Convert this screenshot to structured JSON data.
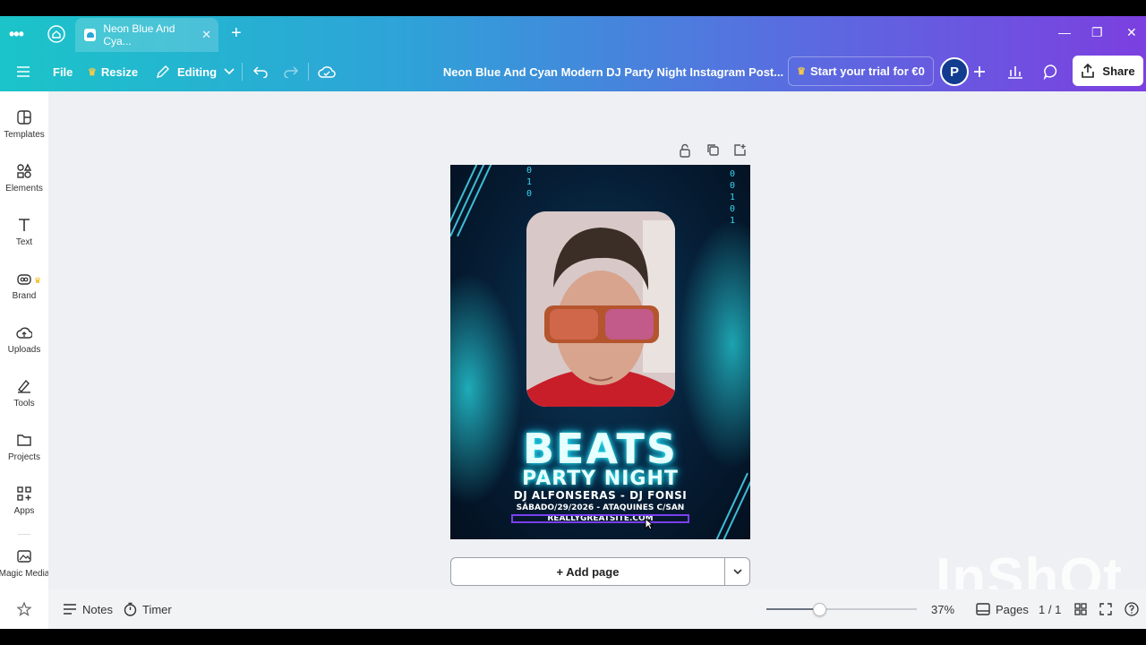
{
  "browser": {
    "tab_title": "Neon Blue And Cya...",
    "tab_close": "✕",
    "new_tab": "+",
    "menu_dots": "•••",
    "window_controls": {
      "minimize": "—",
      "restore": "❐",
      "close": "✕"
    }
  },
  "toolbar": {
    "file_label": "File",
    "resize_label": "Resize",
    "editing_label": "Editing",
    "doc_title": "Neon Blue And Cyan Modern DJ Party Night Instagram Post...",
    "trial_label": "Start your trial for €0",
    "avatar_initial": "P",
    "share_label": "Share"
  },
  "sidebar": {
    "items": [
      {
        "label": "Templates",
        "icon": "templates-icon"
      },
      {
        "label": "Elements",
        "icon": "elements-icon"
      },
      {
        "label": "Text",
        "icon": "text-icon"
      },
      {
        "label": "Brand",
        "icon": "brand-icon"
      },
      {
        "label": "Uploads",
        "icon": "uploads-icon"
      },
      {
        "label": "Tools",
        "icon": "tools-icon"
      },
      {
        "label": "Projects",
        "icon": "projects-icon"
      },
      {
        "label": "Apps",
        "icon": "apps-icon"
      },
      {
        "label": "Magic Media",
        "icon": "magic-media-icon"
      }
    ]
  },
  "design": {
    "title_big": "BEATS",
    "title_sub": "PARTY NIGHT",
    "djs": "DJ ALFONSERAS - DJ FONSI",
    "date_line": "SÁBADO/29/2026 - ATAQUINES C/SAN",
    "website": "REALLYGREATSITE.COM",
    "binary_left": "0\n1\n0",
    "binary_right": "0\n0\n1\n0\n1"
  },
  "canvas": {
    "add_page_label": "+ Add page"
  },
  "bottombar": {
    "notes_label": "Notes",
    "timer_label": "Timer",
    "zoom_value": "37%",
    "zoom_level": 0.35,
    "pages_label": "Pages",
    "page_counter": "1 / 1"
  },
  "watermark": "InShOt",
  "colors": {
    "chrome_start": "#1bc4c9",
    "chrome_end": "#7c3fe0",
    "selection": "#7a3ff0",
    "neon": "#39d3f0"
  }
}
